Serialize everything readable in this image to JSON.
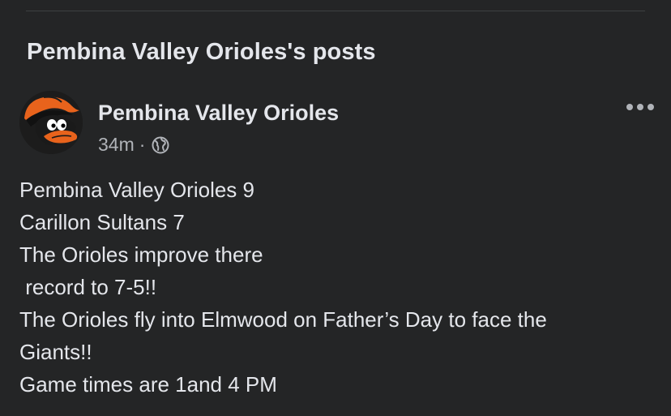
{
  "section": {
    "title": "Pembina Valley Orioles's posts"
  },
  "post": {
    "author": "Pembina Valley Orioles",
    "time": "34m",
    "separator": "·",
    "avatar_icon": "orioles-logo-icon",
    "privacy_icon": "globe-icon",
    "more_icon": "more-options-icon",
    "lines": [
      "Pembina Valley Orioles 9",
      "Carillon Sultans 7",
      "The Orioles improve there",
      " record to 7-5!!",
      "The Orioles fly into Elmwood on Father’s Day to face the",
      "Giants!!",
      "Game times are 1and 4 PM"
    ]
  },
  "colors": {
    "background": "#242526",
    "primary_text": "#e4e6eb",
    "secondary_text": "#b0b3b8",
    "divider": "#3e4042",
    "oriole_orange": "#e8631c"
  }
}
